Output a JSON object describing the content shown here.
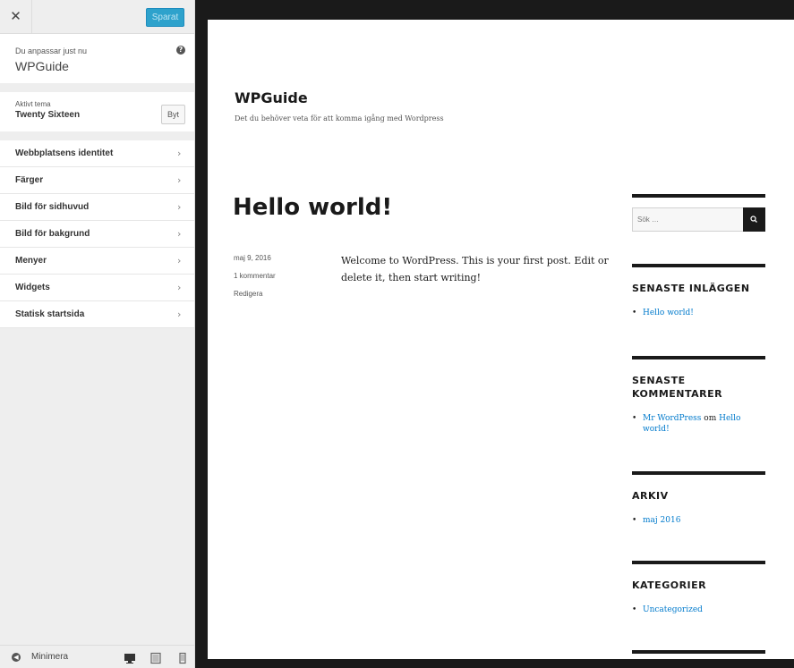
{
  "customizer": {
    "close_symbol": "✕",
    "save_label": "Sparat",
    "info": {
      "label": "Du anpassar just nu",
      "title": "WPGuide",
      "help_symbol": "?"
    },
    "theme": {
      "label": "Aktivt tema",
      "name": "Twenty Sixteen",
      "change_label": "Byt"
    },
    "menu_items": [
      {
        "label": "Webbplatsens identitet"
      },
      {
        "label": "Färger"
      },
      {
        "label": "Bild för sidhuvud"
      },
      {
        "label": "Bild för bakgrund"
      },
      {
        "label": "Menyer"
      },
      {
        "label": "Widgets"
      },
      {
        "label": "Statisk startsida"
      }
    ],
    "chevron": "›",
    "footer": {
      "collapse_label": "Minimera",
      "collapse_symbol": "◀",
      "devices": [
        "desktop-icon",
        "tablet-icon",
        "mobile-icon"
      ]
    }
  },
  "preview": {
    "site_title": "WPGuide",
    "site_description": "Det du behöver veta för att komma igång med Wordpress",
    "post": {
      "title": "Hello world!",
      "date": "maj 9, 2016",
      "comments": "1 kommentar",
      "edit": "Redigera",
      "content": "Welcome to WordPress. This is your first post. Edit or delete it, then start writing!"
    },
    "search": {
      "placeholder": "Sök …"
    },
    "widgets": {
      "recent_posts": {
        "title": "SENASTE INLÄGGEN",
        "items": [
          "Hello world!"
        ]
      },
      "recent_comments": {
        "title": "SENASTE KOMMENTARER",
        "author": "Mr WordPress",
        "connector": "om",
        "post": "Hello world!"
      },
      "archives": {
        "title": "ARKIV",
        "items": [
          "maj 2016"
        ]
      },
      "categories": {
        "title": "KATEGORIER",
        "items": [
          "Uncategorized"
        ]
      }
    }
  },
  "colors": {
    "save_button": "#2ea2cc",
    "link": "#007acc",
    "sidebar_bg": "#eeeeee",
    "frame": "#1a1a1a"
  }
}
